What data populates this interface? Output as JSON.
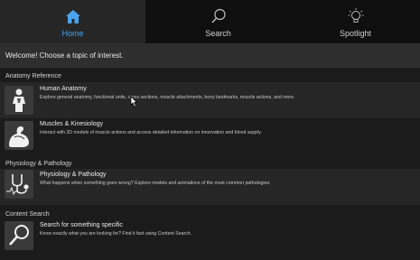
{
  "tabs": [
    {
      "label": "Home",
      "icon": "home-icon",
      "active": true
    },
    {
      "label": "Search",
      "icon": "search-icon",
      "active": false
    },
    {
      "label": "Spotlight",
      "icon": "lightbulb-icon",
      "active": false
    }
  ],
  "welcome": "Welcome! Choose a topic of interest.",
  "sections": [
    {
      "header": "Anatomy Reference",
      "items": [
        {
          "title": "Human Anatomy",
          "description": "Explore general anatomy, functional units, cross sections, muscle attachments, bony landmarks, muscle actions, and more.",
          "icon": "body-figure-icon"
        },
        {
          "title": "Muscles & Kinesiology",
          "description": "Interact with 3D models of muscle actions and access detailed information on innervation and blood supply.",
          "icon": "flexed-arm-icon"
        }
      ]
    },
    {
      "header": "Physiology & Pathology",
      "items": [
        {
          "title": "Physiology & Pathology",
          "description": "What happens when something goes wrong? Explore models and animations of the most common pathologies.",
          "icon": "stethoscope-icon"
        }
      ]
    },
    {
      "header": "Content Search",
      "items": [
        {
          "title": "Search for something specific",
          "description": "Know exactly what you are looking for? Find it fast using Content Search.",
          "icon": "magnifier-icon"
        }
      ]
    }
  ],
  "colors": {
    "accent": "#4aa3ee",
    "background": "#1b1b1b",
    "tabbar": "#0f0f0f"
  }
}
